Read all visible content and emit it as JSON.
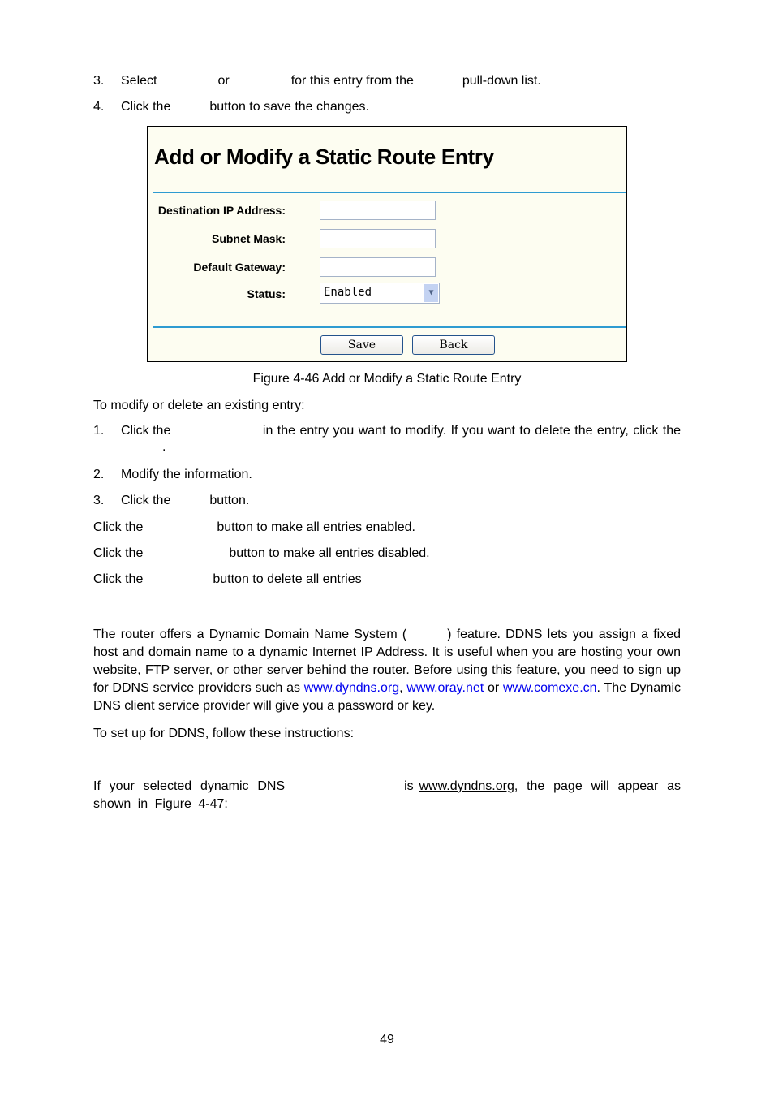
{
  "steps_top": [
    {
      "num": "3.",
      "parts": [
        "Select",
        "or",
        "for this entry from the",
        "pull-down list."
      ]
    },
    {
      "num": "4.",
      "parts": [
        "Click the",
        "button to save the changes."
      ]
    }
  ],
  "figure": {
    "title": "Add or Modify a Static Route Entry",
    "fields": [
      {
        "label": "Destination IP Address:",
        "value": ""
      },
      {
        "label": "Subnet Mask:",
        "value": ""
      },
      {
        "label": "Default Gateway:",
        "value": ""
      }
    ],
    "status": {
      "label": "Status:",
      "value": "Enabled"
    },
    "buttons": {
      "save": "Save",
      "back": "Back"
    },
    "colors": {
      "background": "#fdfdf1",
      "rule": "#2e9bd1"
    }
  },
  "caption": "Figure 4-46 Add or Modify a Static Route Entry",
  "modify_intro": "To modify or delete an existing entry:",
  "modify_steps": [
    {
      "num": "1.",
      "parts": [
        "Click the",
        "in the entry you want to modify. If you want to delete the entry, click the"
      ],
      "continuation": "."
    },
    {
      "num": "2.",
      "parts": [
        "Modify the information."
      ]
    },
    {
      "num": "3.",
      "parts": [
        "Click the",
        "button."
      ]
    }
  ],
  "click_lines": [
    {
      "parts": [
        "Click the",
        "button to make all entries enabled."
      ]
    },
    {
      "parts": [
        "Click the",
        "button to make all entries disabled."
      ]
    },
    {
      "parts": [
        "Click the",
        "button to delete all entries"
      ]
    }
  ],
  "ddns": {
    "p1_a": "The router offers a Dynamic Domain Name System (",
    "p1_b": ") feature. DDNS lets you assign a fixed host and domain name to a dynamic Internet IP Address. It is useful when you are hosting your own website, FTP server, or other server behind the router. Before using this feature, you need to sign up for DDNS service providers such as ",
    "link1": "www.dyndns.org",
    "sep1": ", ",
    "link2": "www.oray.net",
    "sep2": " or ",
    "link3": "www.comexe.cn",
    "p1_c": ". The Dynamic DNS client service provider will give you a password or key.",
    "p2": "To set up for DDNS, follow these instructions:",
    "p3_a": "If your selected dynamic DNS",
    "p3_b": "is ",
    "p3_link": "www.dyndns.org",
    "p3_c": ", the page will appear as shown in Figure 4-47:"
  },
  "page_number": "49"
}
